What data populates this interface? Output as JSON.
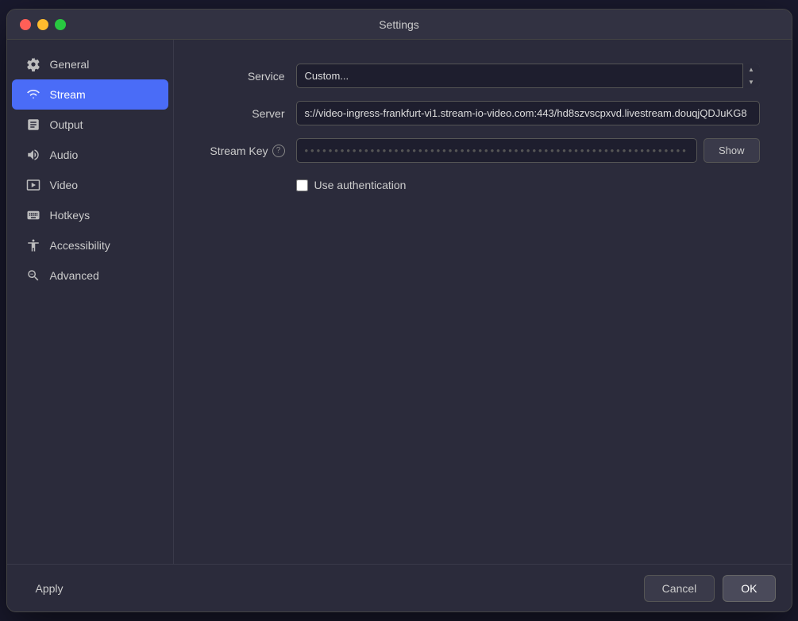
{
  "window": {
    "title": "Settings"
  },
  "sidebar": {
    "items": [
      {
        "id": "general",
        "label": "General",
        "icon": "gear",
        "active": false
      },
      {
        "id": "stream",
        "label": "Stream",
        "icon": "stream",
        "active": true
      },
      {
        "id": "output",
        "label": "Output",
        "icon": "output",
        "active": false
      },
      {
        "id": "audio",
        "label": "Audio",
        "icon": "audio",
        "active": false
      },
      {
        "id": "video",
        "label": "Video",
        "icon": "video",
        "active": false
      },
      {
        "id": "hotkeys",
        "label": "Hotkeys",
        "icon": "hotkeys",
        "active": false
      },
      {
        "id": "accessibility",
        "label": "Accessibility",
        "icon": "accessibility",
        "active": false
      },
      {
        "id": "advanced",
        "label": "Advanced",
        "icon": "advanced",
        "active": false
      }
    ]
  },
  "content": {
    "service_label": "Service",
    "service_value": "Custom...",
    "server_label": "Server",
    "server_value": "s://video-ingress-frankfurt-vi1.stream-io-video.com:443/hd8szvscpxvd.livestream.douqjQDJuKG8",
    "stream_key_label": "Stream Key",
    "stream_key_value": "••••••••••••••••••••••••••••••••••••••••••••••••••••••••••••••••••••••••••••••••••••••••••••••••••••",
    "show_button_label": "Show",
    "use_auth_label": "Use authentication",
    "use_auth_checked": false
  },
  "footer": {
    "apply_label": "Apply",
    "cancel_label": "Cancel",
    "ok_label": "OK"
  }
}
